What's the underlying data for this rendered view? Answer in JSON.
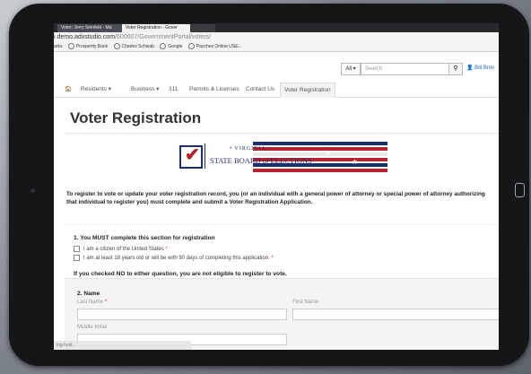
{
  "browser": {
    "tabs": [
      {
        "label": "Voter: Jerry Seinfeld - Mic"
      },
      {
        "label": "Voter Registration - Gover"
      }
    ],
    "address": {
      "prefix": "i.demo.adxstudio.com",
      "path": "/600007/GovernmentPortal/voters/"
    },
    "bookmarks": [
      "arks",
      "Prosperity Bank",
      "Charles Schwab",
      "Google",
      "Paychex Online USE..."
    ]
  },
  "header": {
    "scope": "All",
    "search_placeholder": "Search",
    "user_name": "Bill Brov"
  },
  "nav": {
    "home_icon": "home-icon",
    "items": [
      {
        "label": "Residents"
      },
      {
        "label": "Business"
      },
      {
        "label": "311"
      },
      {
        "label": "Permits & Licenses"
      },
      {
        "label": "Contact Us"
      },
      {
        "label": "Voter Registration"
      }
    ]
  },
  "page": {
    "title": "Voter Registration",
    "banner": {
      "line1": "• VIRGINIA •",
      "line2_a": "STATE BOARD",
      "line2_b": "of",
      "line2_c": "ELECTIONS"
    },
    "intro": "To register to vote or update your voter registration record, you (or an individual with a general power of attorney or special power of attorney authorizing that individual to register you) must complete and submit a Voter Registration Application.",
    "section1": {
      "title": "1. You MUST complete this section for registration",
      "checks": [
        {
          "label": "I am a citizen of the United States",
          "required_mark": "*"
        },
        {
          "label": "I am at least 18 years old or will be with 90 days of completing this application.",
          "required_mark": "*"
        }
      ],
      "notice": "If you checked NO to either question, you are not eligible to register to vote."
    },
    "section2": {
      "title": "2. Name",
      "last_name_label": "Last Name",
      "required_mark": "*",
      "first_name_label": "First Name",
      "middle_initial_label": "Middle Initial"
    }
  },
  "status": {
    "text": "ing host..."
  },
  "colors": {
    "navy": "#1e2f6e",
    "red": "#b4232e",
    "link": "#2a63b7"
  }
}
